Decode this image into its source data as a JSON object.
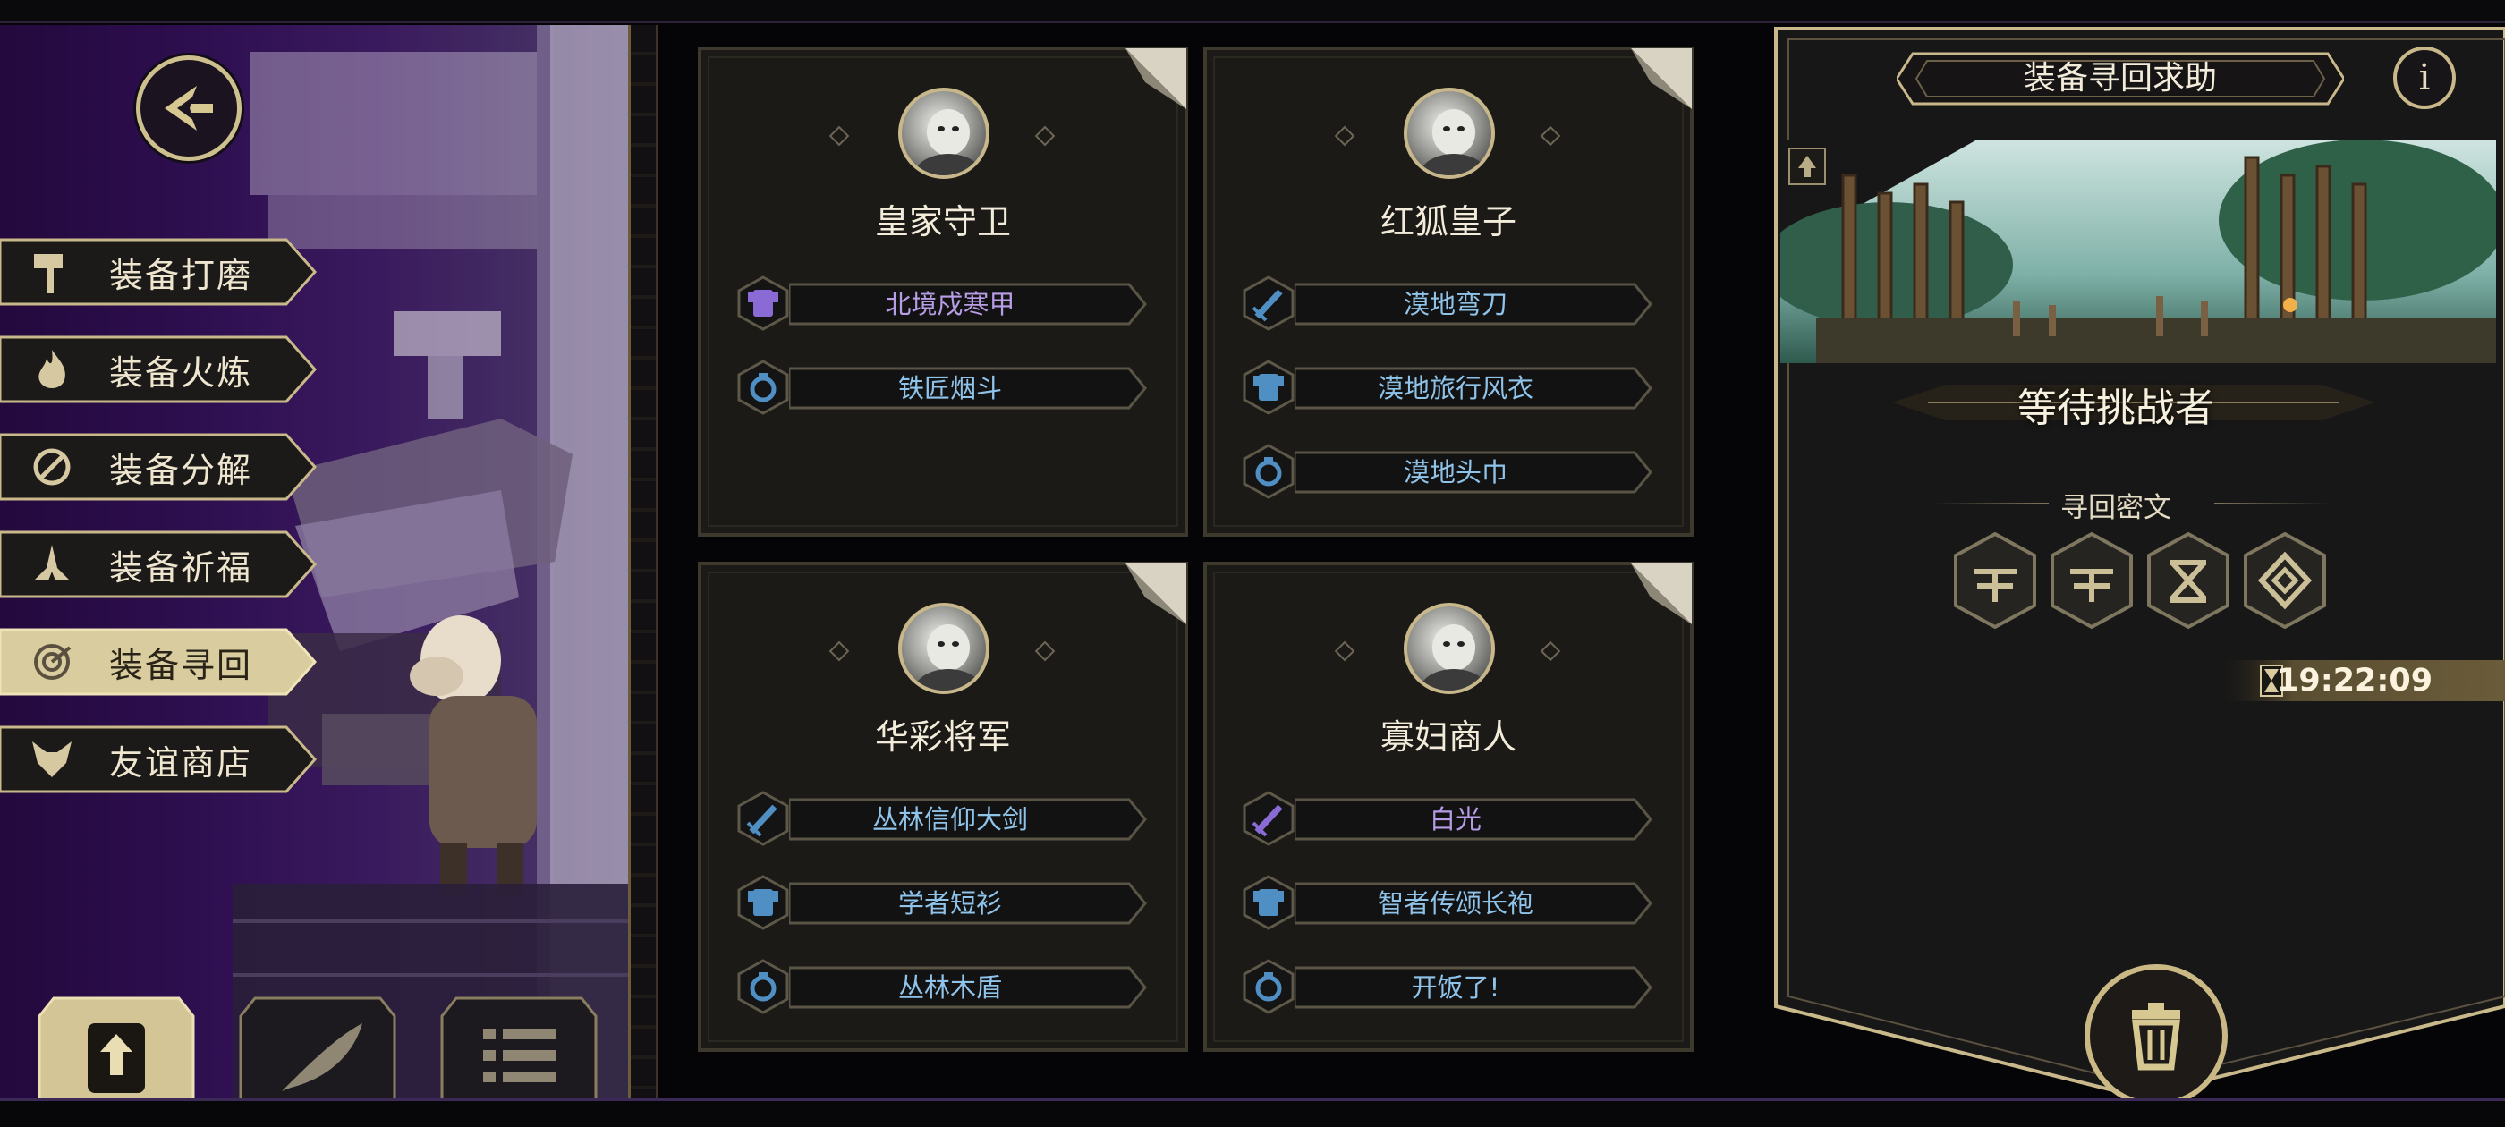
{
  "menu": {
    "items": [
      {
        "label": "装备打磨",
        "icon": "hammer-icon",
        "active": false
      },
      {
        "label": "装备火炼",
        "icon": "flame-icon",
        "active": false
      },
      {
        "label": "装备分解",
        "icon": "disassemble-icon",
        "active": false
      },
      {
        "label": "装备祈福",
        "icon": "praying-hands-icon",
        "active": false
      },
      {
        "label": "装备寻回",
        "icon": "retrieve-spiral-icon",
        "active": true
      },
      {
        "label": "友谊商店",
        "icon": "fox-head-icon",
        "active": false
      }
    ],
    "bottom_tabs": [
      "upload-document-icon",
      "feather-icon",
      "list-icon"
    ]
  },
  "cards": [
    {
      "name": "皇家守卫",
      "items": [
        {
          "label": "北境戍寒甲",
          "icon": "armor-icon",
          "rarity": "epic"
        },
        {
          "label": "铁匠烟斗",
          "icon": "ring-icon",
          "rarity": "rare"
        }
      ]
    },
    {
      "name": "红狐皇子",
      "items": [
        {
          "label": "漠地弯刀",
          "icon": "sword-icon",
          "rarity": "rare"
        },
        {
          "label": "漠地旅行风衣",
          "icon": "armor-icon",
          "rarity": "rare"
        },
        {
          "label": "漠地头巾",
          "icon": "ring-icon",
          "rarity": "rare"
        }
      ]
    },
    {
      "name": "华彩将军",
      "items": [
        {
          "label": "丛林信仰大剑",
          "icon": "sword-icon",
          "rarity": "rare"
        },
        {
          "label": "学者短衫",
          "icon": "armor-icon",
          "rarity": "rare"
        },
        {
          "label": "丛林木盾",
          "icon": "ring-icon",
          "rarity": "rare"
        }
      ]
    },
    {
      "name": "寡妇商人",
      "items": [
        {
          "label": "白光",
          "icon": "sword-icon",
          "rarity": "epic"
        },
        {
          "label": "智者传颂长袍",
          "icon": "armor-icon",
          "rarity": "rare"
        },
        {
          "label": "开饭了!",
          "icon": "ring-icon",
          "rarity": "rare"
        }
      ]
    }
  ],
  "right_panel": {
    "title": "装备寻回求助",
    "info_icon_glyph": "i",
    "status": "等待挑战者",
    "cipher_label": "寻回密文",
    "runes": [
      "rune-1-icon",
      "rune-2-icon",
      "rune-3-icon",
      "rune-4-icon"
    ],
    "timer": "19:22:09"
  },
  "colors": {
    "gold": "#c9b98a",
    "item_text_rare": "#8fc3ea",
    "item_text_epic": "#b79de6",
    "icon_epic": "#8a6bd6",
    "icon_rare": "#4f8fc4",
    "left_bg": "#2d0e4f"
  }
}
